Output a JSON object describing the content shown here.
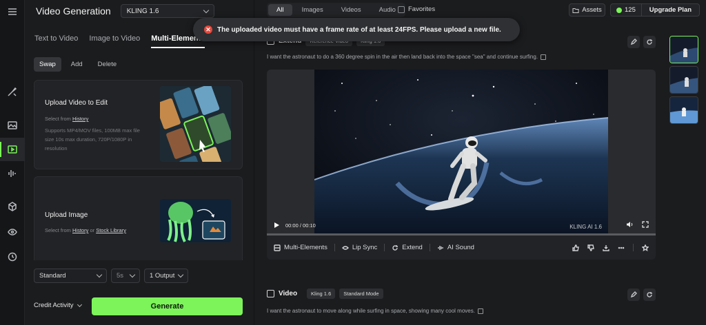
{
  "app": {
    "title": "Video Generation",
    "model": "KLING 1.6"
  },
  "tabs": [
    {
      "label": "Text to Video"
    },
    {
      "label": "Image to Video"
    },
    {
      "label": "Multi-Elements"
    }
  ],
  "subtabs": [
    {
      "label": "Swap"
    },
    {
      "label": "Add"
    },
    {
      "label": "Delete"
    }
  ],
  "upload_video": {
    "title": "Upload Video to Edit",
    "select_prefix": "Select from ",
    "history_link": "History",
    "description": "Supports MP4/MOV files, 100MB max file size 10s max duration, 720P/1080P in resolution"
  },
  "upload_image": {
    "title": "Upload Image",
    "select_prefix": "Select from ",
    "history_link": "History",
    "or": " or ",
    "stock_link": "Stock Library"
  },
  "options": {
    "mode": "Standard",
    "duration": "5s",
    "outputs": "1 Output"
  },
  "footer": {
    "credit": "Credit Activity",
    "generate": "Generate"
  },
  "filters": [
    {
      "label": "All"
    },
    {
      "label": "Images"
    },
    {
      "label": "Videos"
    },
    {
      "label": "Audio"
    }
  ],
  "favorites_label": "Favorites",
  "assets_label": "Assets",
  "credits": "125",
  "upgrade_label": "Upgrade Plan",
  "toast": {
    "message": "The uploaded video must have a frame rate of at least 24FPS. Please upload a new file.",
    "icon": "x-circle-icon",
    "color": "#e5483d"
  },
  "extend_section": {
    "title": "Extend",
    "pill1": "Reference Video",
    "pill2": "Kling 1.6",
    "prompt": "I want the astronaut to do a 360 degree spin in the air then land back into the space \"sea\" and continue surfing."
  },
  "player": {
    "time": "00:00 / 00:10",
    "brand": "KLING AI 1.6"
  },
  "actions": {
    "multi": "Multi-Elements",
    "lipsync": "Lip Sync",
    "extend": "Extend",
    "sound": "AI Sound"
  },
  "video_section": {
    "title": "Video",
    "pill1": "Kling 1.6",
    "pill2": "Standard Mode",
    "prompt": "I want the astronaut to move along while surfing in space, showing many cool moves."
  },
  "colors": {
    "accent": "#7cf45a",
    "background": "#1b1c1e",
    "panel": "#222326"
  }
}
